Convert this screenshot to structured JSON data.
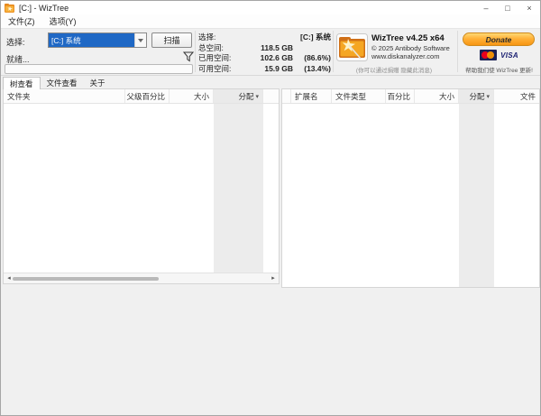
{
  "window": {
    "title": "[C:] - WizTree"
  },
  "icons": {
    "minimize": "–",
    "maximize": "□",
    "close": "×",
    "sort_desc": "▾",
    "scroll_left": "◂",
    "scroll_right": "▸"
  },
  "menu": {
    "items": [
      "文件(Z)",
      "选项(Y)"
    ]
  },
  "toolbar": {
    "select_label": "选择:",
    "drive_selected": "[C:] 系统",
    "scan_button": "扫描",
    "status": "就绪..."
  },
  "info": {
    "select_label": "选择:",
    "select_value": "[C:] 系统",
    "total_label": "总空间:",
    "total_value": "118.5 GB",
    "used_label": "已用空间:",
    "used_value": "102.6 GB",
    "used_pct": "(86.6%)",
    "free_label": "可用空间:",
    "free_value": "15.9 GB",
    "free_pct": "(13.4%)"
  },
  "brand": {
    "name": "WizTree v4.25 x64",
    "copyright": "© 2025 Antibody Software",
    "website": "www.diskanalyzer.com",
    "ad_note": "(你可以通过捐赠 隐藏此消息)"
  },
  "donate": {
    "button_label": "Donate",
    "visa_label": "VISA",
    "note": "帮助我们使 WizTree 更新!"
  },
  "tabs": [
    {
      "label": "树查看"
    },
    {
      "label": "文件查看"
    },
    {
      "label": "关于"
    }
  ],
  "left_table": {
    "columns": [
      "文件夹",
      "父级百分比",
      "大小",
      "分配"
    ],
    "sort_column": "分配",
    "rows": []
  },
  "right_table": {
    "columns": [
      "扩展名",
      "文件类型",
      "百分比",
      "大小",
      "分配",
      "文件"
    ],
    "sort_column": "分配",
    "rows": []
  },
  "colors": {
    "selection_blue": "#1f68c5",
    "donate_orange": "#f79513",
    "window_bg": "#f0f0f0",
    "column_shade": "#ececec"
  }
}
